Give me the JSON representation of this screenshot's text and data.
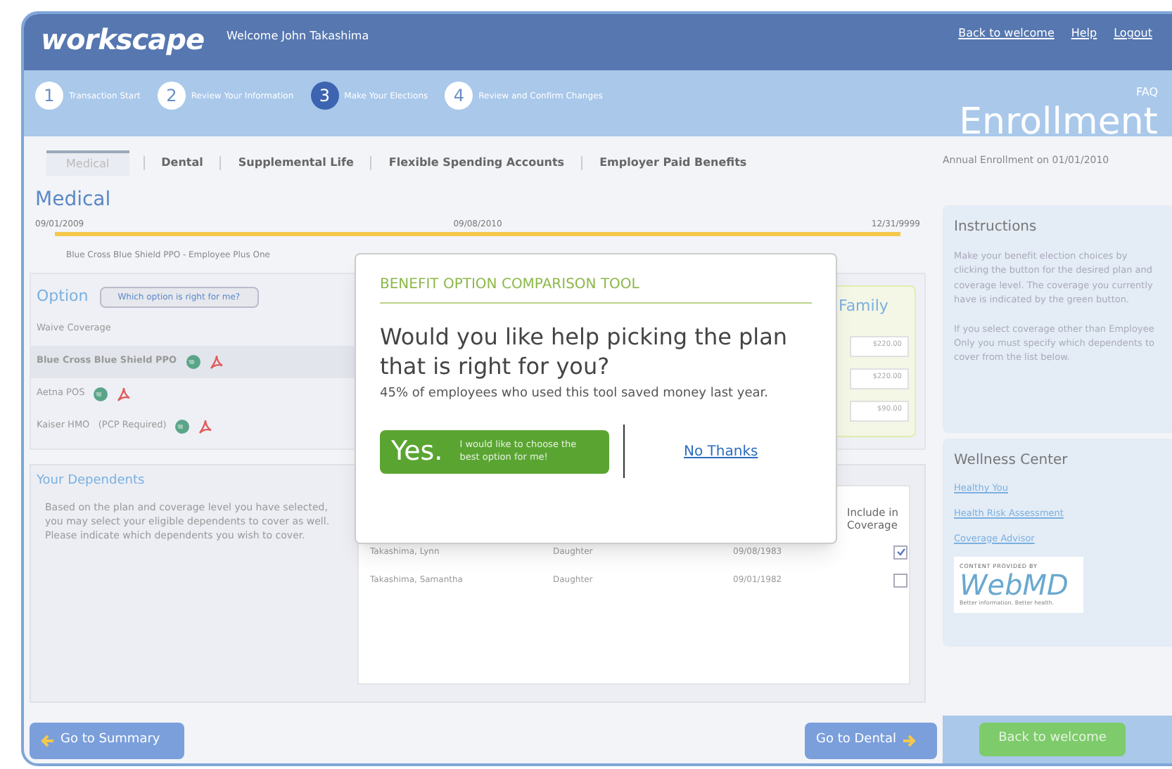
{
  "header": {
    "logo": "workscape",
    "welcome": "Welcome John Takashima",
    "links": [
      "Back to welcome",
      "Help",
      "Logout"
    ]
  },
  "steps": [
    {
      "number": "1",
      "label": "Transaction Start",
      "selected": false
    },
    {
      "number": "2",
      "label": "Review Your Information",
      "selected": false
    },
    {
      "number": "3",
      "label": "Make Your Elections",
      "selected": true
    },
    {
      "number": "4",
      "label": "Review and Confirm Changes",
      "selected": false
    }
  ],
  "faq": "FAQ",
  "page_title": "Enrollment",
  "tabs": [
    {
      "label": "Medical",
      "selected": true
    },
    {
      "label": "Dental",
      "selected": false
    },
    {
      "label": "Supplemental Life",
      "selected": false
    },
    {
      "label": "Flexible Spending Accounts",
      "selected": false
    },
    {
      "label": "Employer Paid Benefits",
      "selected": false
    }
  ],
  "enrollment_note": "Annual Enrollment on 01/01/2010",
  "section_title": "Medical",
  "timeline": {
    "dates": [
      "09/01/2009",
      "09/08/2010",
      "12/31/9999"
    ],
    "plan": "Blue Cross Blue Shield PPO - Employee Plus One"
  },
  "options": {
    "heading": "Option",
    "help_button": "Which option is right for me?",
    "rows": [
      {
        "label": "Waive Coverage",
        "selected": false,
        "icons": false
      },
      {
        "label": "Blue Cross Blue Shield PPO",
        "selected": true,
        "icons": true
      },
      {
        "label": "Aetna POS",
        "selected": false,
        "icons": true
      },
      {
        "label": "Kaiser HMO   (PCP Required)",
        "selected": false,
        "icons": true
      }
    ],
    "family": {
      "heading": "Family",
      "prices": [
        "$220.00",
        "$220.00",
        "$90.00"
      ]
    }
  },
  "dependents": {
    "heading": "Your Dependents",
    "text": "Based on the plan and coverage level you have selected, you may select your eligible dependents to cover as well. Please indicate which dependents you wish to cover.",
    "include_header": "Include in Coverage",
    "rows": [
      {
        "name": "Takashima, Lynn",
        "relation": "Daughter",
        "dob": "09/08/1983",
        "checked": true
      },
      {
        "name": "Takashima, Samantha",
        "relation": "Daughter",
        "dob": "09/01/1982",
        "checked": false
      }
    ]
  },
  "modal": {
    "title": "BENEFIT OPTION COMPARISON TOOL",
    "question": "Would you like help picking the plan that is right for you?",
    "note": "45% of employees who used this tool saved money last year.",
    "yes": "Yes.",
    "yes_detail": "I would like to choose the best option for me!",
    "no": "No Thanks"
  },
  "instructions": {
    "title": "Instructions",
    "paragraphs": [
      "Make your benefit election choices by clicking the button for the desired plan and coverage level. The coverage you currently have is indicated by the green button.",
      "If you select coverage other than Employee Only you must specify which dependents to cover from the list below."
    ]
  },
  "wellness": {
    "title": "Wellness Center",
    "links": [
      "Healthy You",
      "Health Risk Assessment",
      "Coverage Advisor"
    ],
    "badge": {
      "caption": "CONTENT PROVIDED BY",
      "brand": "WebMD",
      "tagline": "Better information. Better health."
    }
  },
  "footer": {
    "back": "Go to Summary",
    "next": "Go to Dental",
    "home": "Back to welcome"
  }
}
